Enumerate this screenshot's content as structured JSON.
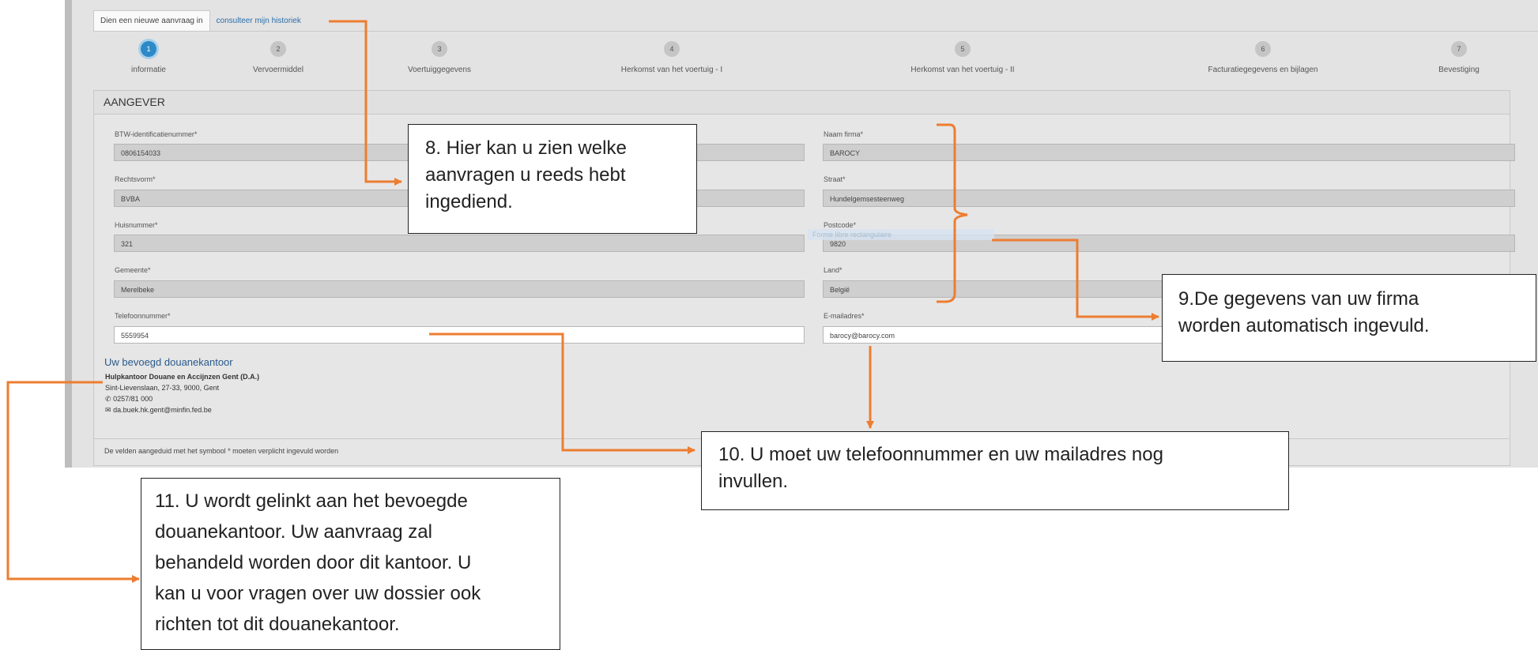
{
  "tabs": {
    "active": "Dien een nieuwe aanvraag in",
    "history": "consulteer mijn historiek"
  },
  "steps": [
    {
      "num": "1",
      "label": "informatie"
    },
    {
      "num": "2",
      "label": "Vervoermiddel"
    },
    {
      "num": "3",
      "label": "Voertuiggegevens"
    },
    {
      "num": "4",
      "label": "Herkomst van het voertuig - I"
    },
    {
      "num": "5",
      "label": "Herkomst van het voertuig - II"
    },
    {
      "num": "6",
      "label": "Facturatiegegevens en bijlagen"
    },
    {
      "num": "7",
      "label": "Bevestiging"
    }
  ],
  "panel": {
    "title": "AANGEVER"
  },
  "fields": {
    "btw": {
      "label": "BTW-identificatienummer*",
      "value": "0806154033"
    },
    "naam": {
      "label": "Naam firma*",
      "value": "BAROCY"
    },
    "rechtsvorm": {
      "label": "Rechtsvorm*",
      "value": "BVBA"
    },
    "straat": {
      "label": "Straat*",
      "value": "Hundelgemsesteenweg"
    },
    "huisnummer": {
      "label": "Huisnummer*",
      "value": "321"
    },
    "postcode": {
      "label": "Postcode*",
      "value": "9820"
    },
    "gemeente": {
      "label": "Gemeente*",
      "value": "Merelbeke"
    },
    "land": {
      "label": "Land*",
      "value": "België"
    },
    "telefoon": {
      "label": "Telefoonnummer*",
      "value": "5559954"
    },
    "email": {
      "label": "E-mailadres*",
      "value": "barocy@barocy.com"
    }
  },
  "office": {
    "title": "Uw bevoegd douanekantoor",
    "name": "Hulpkantoor Douane en Accijnzen Gent (D.A.)",
    "address": "Sint-Lievenslaan, 27-33, 9000, Gent",
    "phone": "0257/81 000",
    "email": "da.buek.hk.gent@minfin.fed.be",
    "phone_icon": "phone-icon",
    "mail_icon": "envelope-icon"
  },
  "footer": "De velden aangeduid met het symbool * moeten verplicht ingevuld worden",
  "ghost_text": "Forme libre rectangulaire",
  "callouts": {
    "c8": [
      "8. Hier kan u zien welke",
      "aanvragen u reeds hebt",
      "ingediend."
    ],
    "c9": [
      "9.De gegevens van uw firma",
      "worden automatisch ingevuld."
    ],
    "c10": [
      "10. U moet uw telefoonnummer en uw mailadres nog",
      "invullen."
    ],
    "c11": [
      "11. U wordt gelinkt aan het bevoegde",
      "douanekantoor. Uw aanvraag zal",
      "behandeld worden door dit kantoor. U",
      "kan u voor vragen over uw dossier ook",
      "richten tot dit douanekantoor."
    ]
  },
  "colors": {
    "accent": "#2d8ac8",
    "arrow": "#ed7d31",
    "link": "#2a6ea8"
  }
}
